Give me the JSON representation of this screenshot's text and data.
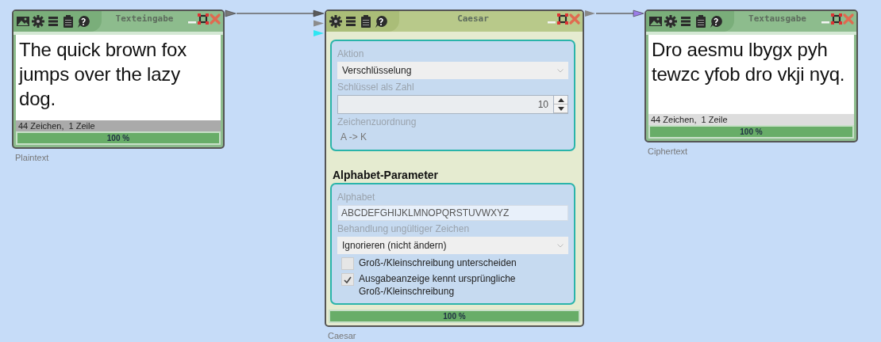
{
  "components": [
    {
      "kind": "text-input",
      "title": "Texteingabe",
      "text": "The quick brown fox jumps over the lazy dog.",
      "status": "44 Zeichen,  1 Zeile",
      "progress": {
        "level": 1,
        "label": "100 %"
      },
      "caption": "Plaintext"
    },
    {
      "kind": "settings",
      "title": "Caesar",
      "input_ports": [
        {
          "color": "#5a5a5a"
        },
        {
          "color": "#8c8c8c"
        },
        {
          "color": "#2ee6f2"
        }
      ],
      "groups": [
        {
          "fields": [
            {
              "kind": "dropdown",
              "label": "Aktion",
              "value": "Verschlüsselung"
            },
            {
              "kind": "number",
              "label": "Schlüssel als Zahl",
              "value": "10"
            },
            {
              "kind": "readout",
              "label": "Zeichenzuordnung",
              "value": "A -> K"
            }
          ]
        },
        {
          "heading": "Alphabet-Parameter",
          "fields": [
            {
              "kind": "text",
              "label": "Alphabet",
              "value": "ABCDEFGHIJKLMNOPQRSTUVWXYZ"
            },
            {
              "kind": "dropdown",
              "label": "Behandlung ungültiger Zeichen",
              "value": "Ignorieren (nicht ändern)"
            },
            {
              "kind": "checkbox",
              "label": "Groß-/Kleinschreibung unterscheiden",
              "checked": false
            },
            {
              "kind": "checkbox",
              "label": "Ausgabeanzeige kennt ursprüngliche Groß-/Kleinschreibung",
              "checked": true
            }
          ]
        }
      ],
      "progress": {
        "level": 1,
        "label": "100 %"
      },
      "caption": "Caesar"
    },
    {
      "kind": "text-output",
      "title": "Textausgabe",
      "text": "Dro aesmu lbygx pyh tewzc yfob dro vkji nyq.",
      "status": "44 Zeichen,  1 Zeile",
      "progress": {
        "level": 1,
        "label": "100 %"
      },
      "caption": "Ciphertext"
    }
  ]
}
